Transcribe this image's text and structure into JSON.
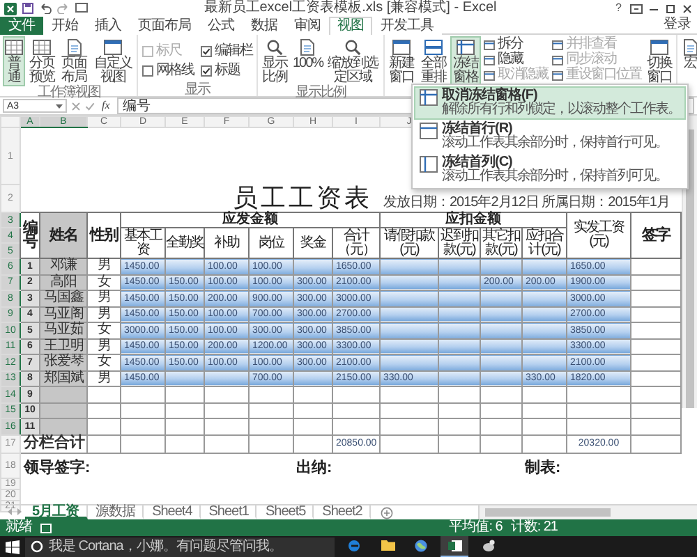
{
  "window": {
    "title": "最新员工excel工资表模板.xls [兼容模式] - Excel",
    "help": "?",
    "sign_in": "登录"
  },
  "ribbon_tabs": [
    {
      "label": "文件",
      "kind": "file",
      "selected": false
    },
    {
      "label": "开始",
      "kind": "tab",
      "selected": false
    },
    {
      "label": "插入",
      "kind": "tab",
      "selected": false
    },
    {
      "label": "页面布局",
      "kind": "tab",
      "selected": false
    },
    {
      "label": "公式",
      "kind": "tab",
      "selected": false
    },
    {
      "label": "数据",
      "kind": "tab",
      "selected": false
    },
    {
      "label": "审阅",
      "kind": "tab",
      "selected": false
    },
    {
      "label": "视图",
      "kind": "tab",
      "selected": true
    },
    {
      "label": "开发工具",
      "kind": "tab",
      "selected": false
    }
  ],
  "ribbon_groups": [
    {
      "label": "工作簿视图",
      "items": [
        {
          "kind": "big",
          "label": "普通",
          "selected": true
        },
        {
          "kind": "big",
          "label": "分页预览",
          "selected": false
        },
        {
          "kind": "big",
          "label": "页面布局",
          "selected": false
        },
        {
          "kind": "big",
          "label": "自定义视图",
          "selected": false
        }
      ]
    },
    {
      "label": "显示",
      "items": [
        {
          "kind": "check",
          "label": "标尺",
          "checked": false,
          "disabled": true
        },
        {
          "kind": "check",
          "label": "网格线",
          "checked": false,
          "disabled": false
        },
        {
          "kind": "check",
          "label": "编辑栏",
          "checked": true,
          "disabled": false
        },
        {
          "kind": "check",
          "label": "标题",
          "checked": true,
          "disabled": false
        }
      ]
    },
    {
      "label": "显示比例",
      "items": [
        {
          "kind": "big",
          "label": "显示比例",
          "selected": false
        },
        {
          "kind": "big",
          "label": "100%",
          "selected": false
        },
        {
          "kind": "big",
          "label": "缩放到选定区域",
          "selected": false
        }
      ]
    },
    {
      "items": [
        {
          "kind": "big",
          "label": "新建窗口",
          "selected": false
        },
        {
          "kind": "big",
          "label": "全部重排",
          "selected": false
        },
        {
          "kind": "big",
          "label": "冻结窗格",
          "selected": true
        },
        {
          "kind": "small",
          "label": "拆分",
          "disabled": false
        },
        {
          "kind": "small",
          "label": "隐藏",
          "disabled": false
        },
        {
          "kind": "small",
          "label": "取消隐藏",
          "disabled": true
        },
        {
          "kind": "small",
          "label": "并排查看",
          "disabled": true
        },
        {
          "kind": "small",
          "label": "同步滚动",
          "disabled": true
        },
        {
          "kind": "small",
          "label": "重设窗口位置",
          "disabled": true
        },
        {
          "kind": "big",
          "label": "切换窗口",
          "selected": false
        }
      ]
    },
    {
      "items": [
        {
          "kind": "big",
          "label": "宏",
          "selected": false
        }
      ]
    }
  ],
  "freeze_menu": [
    {
      "title": "取消冻结窗格(F)",
      "description": "解除所有行和列锁定，以滚动整个工作表。",
      "selected": true
    },
    {
      "title": "冻结首行(R)",
      "description": "滚动工作表其余部分时，保持首行可见。",
      "selected": false
    },
    {
      "title": "冻结首列(C)",
      "description": "滚动工作表其余部分时，保持首列可见。",
      "selected": false
    }
  ],
  "formula_bar": {
    "name_box": "A3",
    "function_label": "fx",
    "value": "编号"
  },
  "columns": [
    {
      "letter": "A",
      "selected": true
    },
    {
      "letter": "B",
      "selected": true
    },
    {
      "letter": "C",
      "selected": false
    },
    {
      "letter": "D",
      "selected": false
    },
    {
      "letter": "E",
      "selected": false
    },
    {
      "letter": "F",
      "selected": false
    },
    {
      "letter": "G",
      "selected": false
    },
    {
      "letter": "H",
      "selected": false
    },
    {
      "letter": "I",
      "selected": false
    },
    {
      "letter": "J",
      "selected": false
    }
  ],
  "row_headers": [
    {
      "label": "1",
      "selected": false
    },
    {
      "label": "2",
      "selected": false
    },
    {
      "label": "3",
      "selected": true
    },
    {
      "label": "4",
      "selected": true
    },
    {
      "label": "5",
      "selected": true
    },
    {
      "label": "6",
      "selected": true
    },
    {
      "label": "7",
      "selected": true
    },
    {
      "label": "8",
      "selected": true
    },
    {
      "label": "9",
      "selected": true
    },
    {
      "label": "10",
      "selected": true
    },
    {
      "label": "11",
      "selected": true
    },
    {
      "label": "12",
      "selected": true
    },
    {
      "label": "13",
      "selected": true
    },
    {
      "label": "14",
      "selected": true
    },
    {
      "label": "15",
      "selected": true
    },
    {
      "label": "16",
      "selected": true
    },
    {
      "label": "17",
      "selected": false
    },
    {
      "label": "18",
      "selected": false
    },
    {
      "label": "19",
      "selected": false
    },
    {
      "label": "20",
      "selected": false
    },
    {
      "label": "21",
      "selected": false
    }
  ],
  "sheet": {
    "title": "员工工资表",
    "date_line": "发放日期：2015年2月12日 所属日期：2015年1月",
    "header": {
      "no": "编号",
      "name": "姓名",
      "gender": "性别",
      "earnings": {
        "label": "应发金额",
        "columns": [
          "基本工资",
          "全勤奖",
          "补助",
          "岗位",
          "奖金",
          "合计（元）"
        ]
      },
      "deductions": {
        "label": "应扣金额",
        "columns": [
          "请假扣款(元)",
          "迟到扣款(元)",
          "其它扣款(元)",
          "应扣合计(元)"
        ]
      },
      "net": "实发工资(元)",
      "signature": "签字"
    },
    "rows": [
      {
        "no": "1",
        "name": "邓谦",
        "gender": "男",
        "cells": {
          "base": "1450.00",
          "allowance": "100.00",
          "post": "100.00",
          "gross": "1650.00",
          "net": "1650.00"
        }
      },
      {
        "no": "2",
        "name": "高阳",
        "gender": "女",
        "cells": {
          "base": "1450.00",
          "attendance": "150.00",
          "allowance": "100.00",
          "post": "100.00",
          "bonus": "300.00",
          "gross": "2100.00",
          "other": "200.00",
          "deduction_total": "200.00",
          "net": "1900.00"
        }
      },
      {
        "no": "3",
        "name": "马国鑫",
        "gender": "男",
        "cells": {
          "base": "1450.00",
          "attendance": "150.00",
          "allowance": "200.00",
          "post": "900.00",
          "bonus": "300.00",
          "gross": "3000.00",
          "net": "3000.00"
        }
      },
      {
        "no": "4",
        "name": "马亚阁",
        "gender": "男",
        "cells": {
          "base": "1450.00",
          "attendance": "150.00",
          "allowance": "100.00",
          "post": "700.00",
          "bonus": "300.00",
          "gross": "2700.00",
          "net": "2700.00"
        }
      },
      {
        "no": "5",
        "name": "马亚茹",
        "gender": "女",
        "cells": {
          "base": "3000.00",
          "attendance": "150.00",
          "allowance": "100.00",
          "post": "300.00",
          "bonus": "300.00",
          "gross": "3850.00",
          "net": "3850.00"
        }
      },
      {
        "no": "6",
        "name": "王卫明",
        "gender": "男",
        "cells": {
          "base": "1450.00",
          "attendance": "150.00",
          "allowance": "200.00",
          "post": "1200.00",
          "bonus": "300.00",
          "gross": "3300.00",
          "net": "3300.00"
        }
      },
      {
        "no": "7",
        "name": "张爱琴",
        "gender": "女",
        "cells": {
          "base": "1450.00",
          "attendance": "150.00",
          "allowance": "100.00",
          "post": "100.00",
          "bonus": "300.00",
          "gross": "2100.00",
          "net": "2100.00"
        }
      },
      {
        "no": "8",
        "name": "郑国斌",
        "gender": "男",
        "cells": {
          "base": "1450.00",
          "post": "700.00",
          "gross": "2150.00",
          "leave": "330.00",
          "deduction_total": "330.00",
          "net": "1820.00"
        }
      },
      {
        "no": "9"
      },
      {
        "no": "10"
      },
      {
        "no": "11"
      }
    ],
    "total": {
      "label": "分栏合计",
      "gross": "20850.00",
      "net": "20320.00"
    },
    "signatures": [
      "领导签字:",
      "出纳:",
      "制表:"
    ]
  },
  "sheet_tabs": [
    {
      "label": "5月工资",
      "selected": true
    },
    {
      "label": "源数据",
      "selected": false
    },
    {
      "label": "Sheet4",
      "selected": false
    },
    {
      "label": "Sheet1",
      "selected": false
    },
    {
      "label": "Sheet5",
      "selected": false
    },
    {
      "label": "Sheet2",
      "selected": false
    }
  ],
  "status_bar": {
    "mode": "就绪",
    "stats": [
      "平均值: 6",
      "计数: 21"
    ]
  },
  "taskbar": {
    "search": {
      "placeholder": "我是 Cortana，小娜。有问题尽管问我。"
    },
    "apps": [
      {
        "selected": false
      },
      {
        "selected": false
      },
      {
        "selected": false
      },
      {
        "selected": true
      },
      {
        "selected": false
      }
    ]
  }
}
